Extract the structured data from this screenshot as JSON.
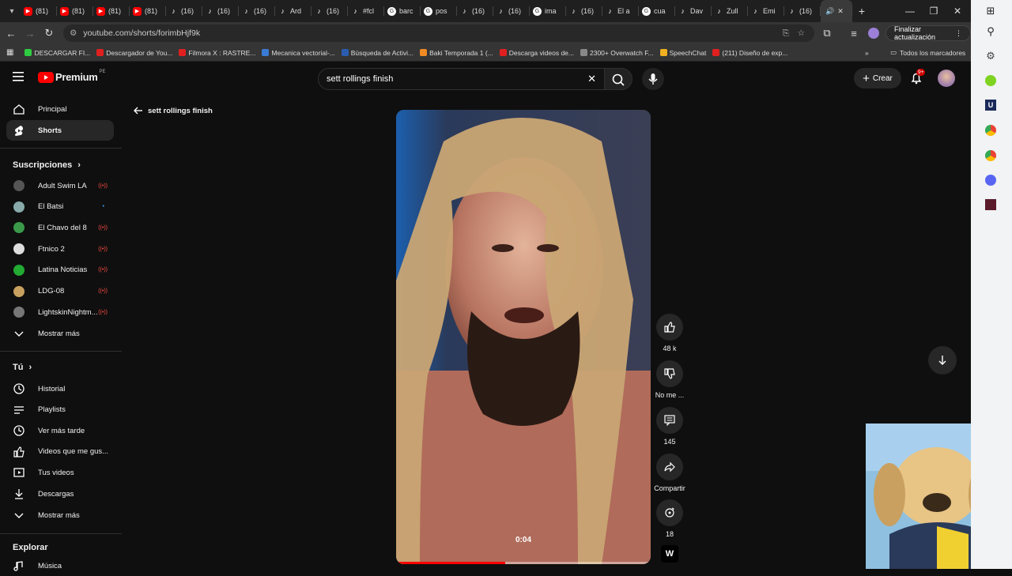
{
  "browser": {
    "tabs": [
      {
        "label": "(81)",
        "icon": "youtube-icon"
      },
      {
        "label": "(81)",
        "icon": "youtube-icon"
      },
      {
        "label": "(81)",
        "icon": "youtube-icon"
      },
      {
        "label": "(81)",
        "icon": "youtube-icon"
      },
      {
        "label": "(16)",
        "icon": "tiktok-icon"
      },
      {
        "label": "(16)",
        "icon": "tiktok-icon"
      },
      {
        "label": "(16)",
        "icon": "tiktok-icon"
      },
      {
        "label": "Ard",
        "icon": "tiktok-icon"
      },
      {
        "label": "(16)",
        "icon": "tiktok-icon"
      },
      {
        "label": "#fcl",
        "icon": "tiktok-icon"
      },
      {
        "label": "barc",
        "icon": "google-icon"
      },
      {
        "label": "pos",
        "icon": "google-icon"
      },
      {
        "label": "(16)",
        "icon": "tiktok-icon"
      },
      {
        "label": "(16)",
        "icon": "tiktok-icon"
      },
      {
        "label": "ima",
        "icon": "google-icon"
      },
      {
        "label": "(16)",
        "icon": "tiktok-icon"
      },
      {
        "label": "El a",
        "icon": "tiktok-icon"
      },
      {
        "label": "cua",
        "icon": "google-icon"
      },
      {
        "label": "Dav",
        "icon": "tiktok-icon"
      },
      {
        "label": "Zull",
        "icon": "tiktok-icon"
      },
      {
        "label": "Emi",
        "icon": "tiktok-icon"
      },
      {
        "label": "(16)",
        "icon": "tiktok-icon"
      }
    ],
    "url": "youtube.com/shorts/forimbHjf9k",
    "update_label": "Finalizar actualización",
    "bookmarks": [
      {
        "label": "DESCARGAR FI...",
        "color": "#2ecc40"
      },
      {
        "label": "Descargador de You...",
        "color": "#e02020"
      },
      {
        "label": "Filmora X : RASTRE...",
        "color": "#e02020"
      },
      {
        "label": "Mecanica vectorial-...",
        "color": "#3a7bd5"
      },
      {
        "label": "Búsqueda de Activi...",
        "color": "#2a5db0"
      },
      {
        "label": "Baki Temporada 1 (...",
        "color": "#f08a24"
      },
      {
        "label": "Descarga videos de...",
        "color": "#e02020"
      },
      {
        "label": "2300+ Overwatch F...",
        "color": "#888888"
      },
      {
        "label": "SpeechChat",
        "color": "#f0b020"
      },
      {
        "label": "(211) Diseño de exp...",
        "color": "#e02020"
      }
    ],
    "all_bookmarks": "Todos los marcadores"
  },
  "youtube": {
    "logo_text": "Premium",
    "logo_badge": "PE",
    "search_value": "sett rollings finish",
    "create_label": "Crear",
    "notif_badge": "9+",
    "back_query": "sett rollings finish"
  },
  "sidebar": {
    "main": [
      {
        "label": "Principal",
        "icon": "home-icon"
      },
      {
        "label": "Shorts",
        "icon": "shorts-icon",
        "active": true
      }
    ],
    "subs_title": "Suscripciones",
    "subs": [
      {
        "label": "Adult Swim LA",
        "color": "#555",
        "live": true
      },
      {
        "label": "El Batsi",
        "color": "#8aa",
        "live": false
      },
      {
        "label": "El Chavo del 8",
        "color": "#3a9a4a",
        "live": true
      },
      {
        "label": "Ftnico 2",
        "color": "#ddd",
        "live": true
      },
      {
        "label": "Latina Noticias",
        "color": "#22aa33",
        "live": true
      },
      {
        "label": "LDG-08",
        "color": "#c8a060",
        "live": true
      },
      {
        "label": "LightskinNightm...",
        "color": "#777",
        "live": true
      }
    ],
    "more1": "Mostrar más",
    "you_title": "Tú",
    "you": [
      {
        "label": "Historial",
        "icon": "history-icon"
      },
      {
        "label": "Playlists",
        "icon": "playlists-icon"
      },
      {
        "label": "Ver más tarde",
        "icon": "clock-icon"
      },
      {
        "label": "Videos que me gus...",
        "icon": "like-icon"
      },
      {
        "label": "Tus videos",
        "icon": "your-videos-icon"
      },
      {
        "label": "Descargas",
        "icon": "download-icon"
      }
    ],
    "more2": "Mostrar más",
    "explore_title": "Explorar",
    "explore": [
      {
        "label": "Música",
        "icon": "music-icon"
      }
    ]
  },
  "short": {
    "timestamp": "0:04",
    "progress": 0.43,
    "likes": "48 k",
    "dislike_label": "No me ...",
    "comments": "145",
    "share_label": "Compartir",
    "remix": "18"
  },
  "colors": {
    "accent": "#ff0000",
    "bg": "#0f0f0f"
  }
}
